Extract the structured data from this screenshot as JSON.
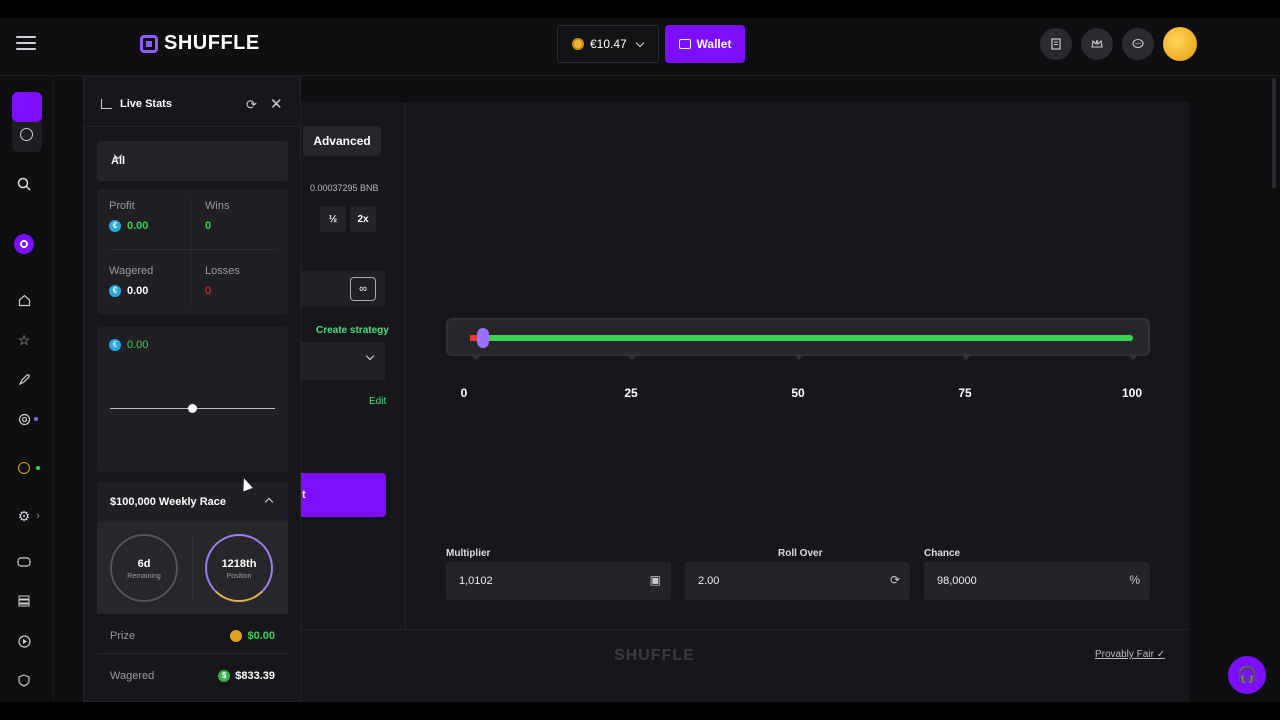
{
  "header": {
    "brand": "SHUFFLE",
    "balance": "€10.47",
    "wallet_label": "Wallet"
  },
  "live_stats": {
    "title": "Live Stats",
    "filter": "All",
    "profit_label": "Profit",
    "profit_value": "0.00",
    "wins_label": "Wins",
    "wins_value": "0",
    "wagered_label": "Wagered",
    "wagered_value": "0.00",
    "losses_label": "Losses",
    "losses_value": "0",
    "graph_value": "0.00"
  },
  "race": {
    "title": "$100,000 Weekly Race",
    "remaining_value": "6d",
    "remaining_label": "Remaining",
    "position_value": "1218th",
    "position_label": "Position",
    "prize_label": "Prize",
    "prize_value": "$0.00",
    "wagered_label": "Wagered",
    "wagered_value": "$833.39"
  },
  "controls": {
    "advanced_tab": "Advanced",
    "bet_balance": "0.00037295 BNB",
    "half_label": "½",
    "double_label": "2x",
    "infinite_label": "∞",
    "create_strategy": "Create strategy",
    "edit_label": "Edit",
    "bet_button_partial": "t"
  },
  "dice": {
    "ticks": [
      "0",
      "25",
      "50",
      "75",
      "100"
    ],
    "roll_over_value": 2,
    "multiplier_label": "Multiplier",
    "multiplier_value": "1,0102",
    "roll_over_label": "Roll Over",
    "roll_over_field": "2.00",
    "chance_label": "Chance",
    "chance_value": "98,0000",
    "chance_unit": "%"
  },
  "footer": {
    "brand": "SHUFFLE",
    "provably_fair": "Provably Fair"
  },
  "colors": {
    "accent": "#7c0fff",
    "win_green": "#38d552",
    "loss_red": "#e53935"
  }
}
